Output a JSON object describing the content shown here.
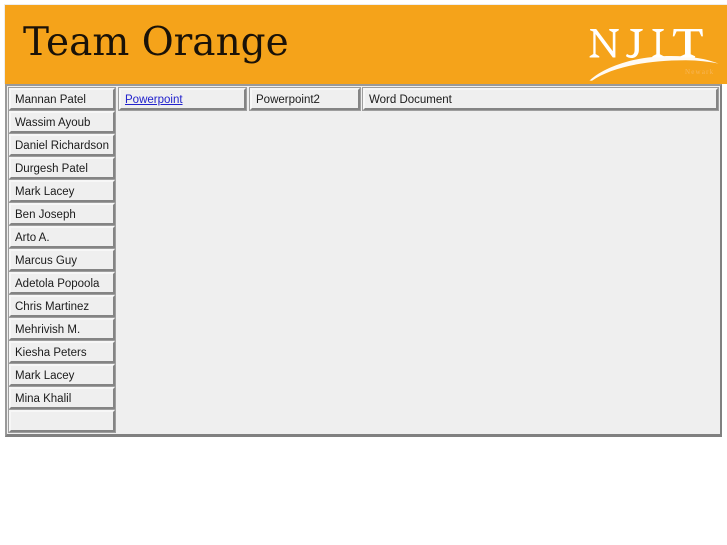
{
  "banner": {
    "title": "Team Orange",
    "background_color": "#f5a31a",
    "logo_name": "njit-logo",
    "logo_text": "N J I T",
    "logo_subtext": "Newark"
  },
  "page": {
    "background_color": "#ffffff",
    "table_background_color": "#efefef",
    "link_color": "#2222cc"
  },
  "table": {
    "header_row": [
      {
        "label": "Mannan Patel",
        "is_link": false
      },
      {
        "label": "Powerpoint",
        "is_link": true
      },
      {
        "label": "Powerpoint2",
        "is_link": false
      },
      {
        "label": "Word Document",
        "is_link": false
      }
    ],
    "name_rows": [
      {
        "label": "Wassim Ayoub"
      },
      {
        "label": "Daniel Richardson"
      },
      {
        "label": "Durgesh Patel"
      },
      {
        "label": "Mark Lacey"
      },
      {
        "label": "Ben Joseph"
      },
      {
        "label": "Arto A."
      },
      {
        "label": "Marcus Guy"
      },
      {
        "label": "Adetola Popoola"
      },
      {
        "label": "Chris Martinez"
      },
      {
        "label": "Mehrivish M."
      },
      {
        "label": "Kiesha Peters"
      },
      {
        "label": "Mark Lacey"
      },
      {
        "label": "Mina Khalil"
      },
      {
        "label": ""
      }
    ]
  }
}
